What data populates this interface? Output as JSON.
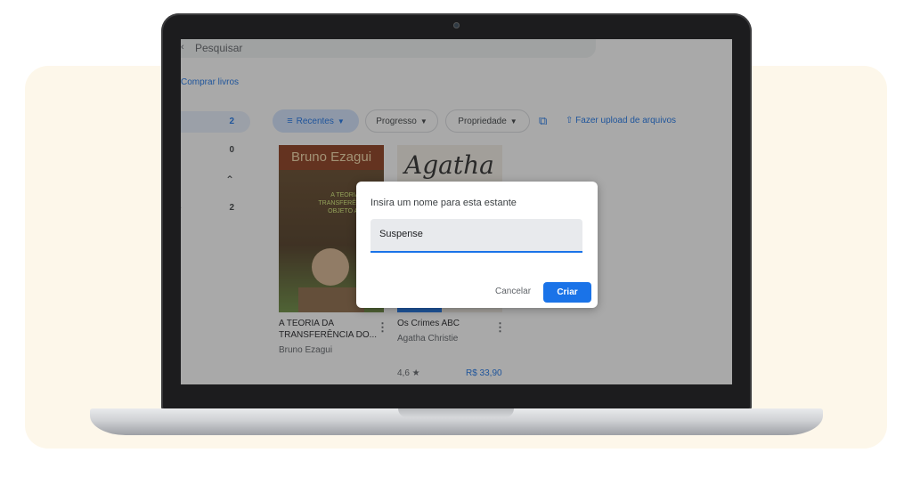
{
  "search": {
    "placeholder": "Pesquisar",
    "icon": "search-icon"
  },
  "sidebar": {
    "buy_link": "Comprar livros",
    "rows": [
      {
        "count": "2"
      },
      {
        "count": "0"
      },
      {
        "count": "2"
      }
    ],
    "collapse_icon": "chevron-up-icon"
  },
  "toolbar": {
    "sort_chip": "Recentes",
    "progress_chip": "Progresso",
    "ownership_chip": "Propriedade",
    "upload_label": "Fazer upload de arquivos"
  },
  "books": [
    {
      "cover_author": "Bruno Ezagui",
      "cover_title": "A TEORIA DA TRANSFERÊNCIA DO OBJETO ADOR",
      "title_line1": "A TEORIA DA",
      "title_line2": "TRANSFERÊNCIA DO...",
      "author": "Bruno Ezagui"
    },
    {
      "cover_signature": "Agatha",
      "title_line1": "Os Crimes ABC",
      "author": "Agatha Christie",
      "rating": "4,6 ★",
      "price": "R$ 33,90"
    }
  ],
  "dialog": {
    "title": "Insira um nome para esta estante",
    "input_value": "Suspense",
    "cancel_label": "Cancelar",
    "create_label": "Criar"
  },
  "colors": {
    "accent": "#1a73e8",
    "backdrop": "#fdf7ea",
    "overlay": "rgba(40,40,40,0.40)"
  }
}
